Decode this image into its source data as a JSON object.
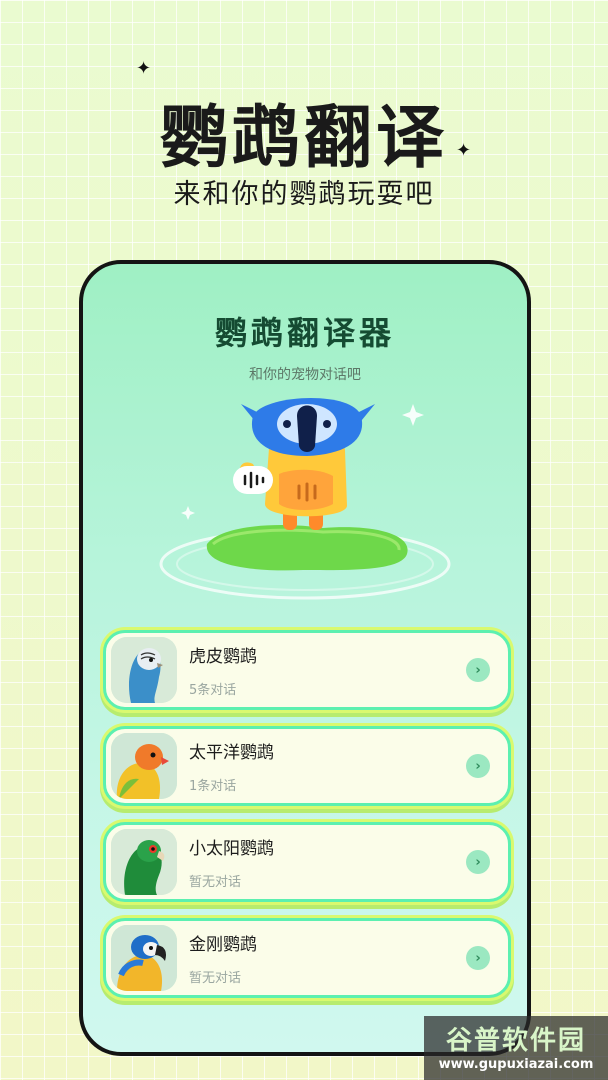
{
  "hero": {
    "title": "鹦鹉翻译",
    "subtitle": "来和你的鹦鹉玩耍吧"
  },
  "app": {
    "title": "鹦鹉翻译器",
    "subtitle": "和你的宠物对话吧",
    "mascot_icon": "parrot-mascot-icon",
    "voice_icon": "voice-wave-icon"
  },
  "parrots": [
    {
      "name": "虎皮鹦鹉",
      "count": "5条对话"
    },
    {
      "name": "太平洋鹦鹉",
      "count": "1条对话"
    },
    {
      "name": "小太阳鹦鹉",
      "count": "暂无对话"
    },
    {
      "name": "金刚鹦鹉",
      "count": "暂无对话"
    }
  ],
  "watermark": {
    "title": "谷普软件园",
    "url": "www.gupuxiazai.com"
  },
  "colors": {
    "accent": "#5cf0b0",
    "title_green": "#154b32",
    "lime": "#d9f96f"
  }
}
